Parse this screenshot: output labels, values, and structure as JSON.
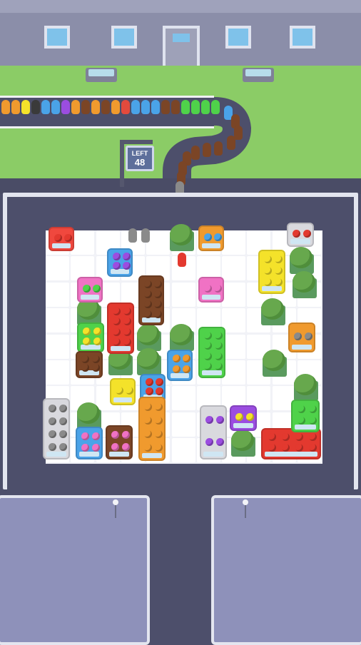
{
  "sign": {
    "line1": "LEFT",
    "count": "48"
  },
  "colors": {
    "red": "#e34a3d",
    "blue": "#4aa3e8",
    "green": "#4fd24a",
    "yellow": "#f4e22a",
    "purple": "#9b4de0",
    "brown": "#7b4526",
    "pink": "#f072c4",
    "gray": "#8a8a8a",
    "orange": "#f09a2e",
    "black": "#3a3a3a"
  },
  "queue": [
    "orange",
    "orange",
    "yellow",
    "black",
    "blue",
    "blue",
    "purple",
    "orange",
    "brown",
    "orange",
    "brown",
    "orange",
    "red",
    "blue",
    "blue",
    "blue",
    "brown",
    "brown",
    "green",
    "green",
    "green",
    "green",
    "blue",
    "brown",
    "brown",
    "brown",
    "brown",
    "brown",
    "brown",
    "brown",
    "brown",
    "brown",
    "gray",
    "gray",
    "gray"
  ],
  "vehicles": [
    {
      "name": "red-car-a",
      "color": "#f0483e",
      "ball": "#e3392f",
      "rows": 1,
      "cols": 2
    },
    {
      "name": "purple-van",
      "color": "#4aa3e8",
      "ball": "#9b4de0",
      "rows": 2,
      "cols": 2
    },
    {
      "name": "blue-car",
      "color": "#f09a2e",
      "ball": "#4aa3e8",
      "rows": 1,
      "cols": 2
    },
    {
      "name": "red-car-b",
      "color": "#d9d9de",
      "ball": "#e3392f",
      "rows": 1,
      "cols": 2
    },
    {
      "name": "yellow-bus",
      "color": "#f4e22a",
      "ball": "#f4e22a",
      "rows": 3,
      "cols": 2
    },
    {
      "name": "green-car",
      "color": "#f072c4",
      "ball": "#4fd24a",
      "rows": 1,
      "cols": 2
    },
    {
      "name": "brown-bus",
      "color": "#7b4526",
      "ball": "#7b4526",
      "rows": 4,
      "cols": 2
    },
    {
      "name": "pink-car",
      "color": "#f072c4",
      "ball": "#f072c4",
      "rows": 1,
      "cols": 2
    },
    {
      "name": "red-bus",
      "color": "#e3392f",
      "ball": "#e3392f",
      "rows": 4,
      "cols": 2
    },
    {
      "name": "yellow-van",
      "color": "#4fd24a",
      "ball": "#f4e22a",
      "rows": 2,
      "cols": 2
    },
    {
      "name": "green-bus",
      "color": "#4fd24a",
      "ball": "#4fd24a",
      "rows": 4,
      "cols": 2
    },
    {
      "name": "gray-car",
      "color": "#f09a2e",
      "ball": "#8a8a8a",
      "rows": 1,
      "cols": 2
    },
    {
      "name": "brown-van",
      "color": "#7b4526",
      "ball": "#7b4526",
      "rows": 2,
      "cols": 2
    },
    {
      "name": "orange-van",
      "color": "#4aa3e8",
      "ball": "#f09a2e",
      "rows": 2,
      "cols": 2
    },
    {
      "name": "yellow-car",
      "color": "#f4e22a",
      "ball": "#f4e22a",
      "rows": 1,
      "cols": 2
    },
    {
      "name": "red-car-c",
      "color": "#4aa3e8",
      "ball": "#e3392f",
      "rows": 2,
      "cols": 2
    },
    {
      "name": "gray-bus",
      "color": "#d9d9de",
      "ball": "#8a8a8a",
      "rows": 4,
      "cols": 2
    },
    {
      "name": "orange-bus",
      "color": "#f09a2e",
      "ball": "#f09a2e",
      "rows": 4,
      "cols": 2
    },
    {
      "name": "pink-van",
      "color": "#7b4526",
      "ball": "#f072c4",
      "rows": 2,
      "cols": 2
    },
    {
      "name": "purple-car",
      "color": "#d9d9de",
      "ball": "#9b4de0",
      "rows": 2,
      "cols": 2
    },
    {
      "name": "yellow-car-b",
      "color": "#9b4de0",
      "ball": "#f4e22a",
      "rows": 1,
      "cols": 2
    },
    {
      "name": "red-bus-b",
      "color": "#e3392f",
      "ball": "#e3392f",
      "rows": 2,
      "cols": 4
    },
    {
      "name": "green-van",
      "color": "#4fd24a",
      "ball": "#4fd24a",
      "rows": 2,
      "cols": 2
    },
    {
      "name": "pink-car-b",
      "color": "#4aa3e8",
      "ball": "#f072c4",
      "rows": 2,
      "cols": 2
    }
  ]
}
